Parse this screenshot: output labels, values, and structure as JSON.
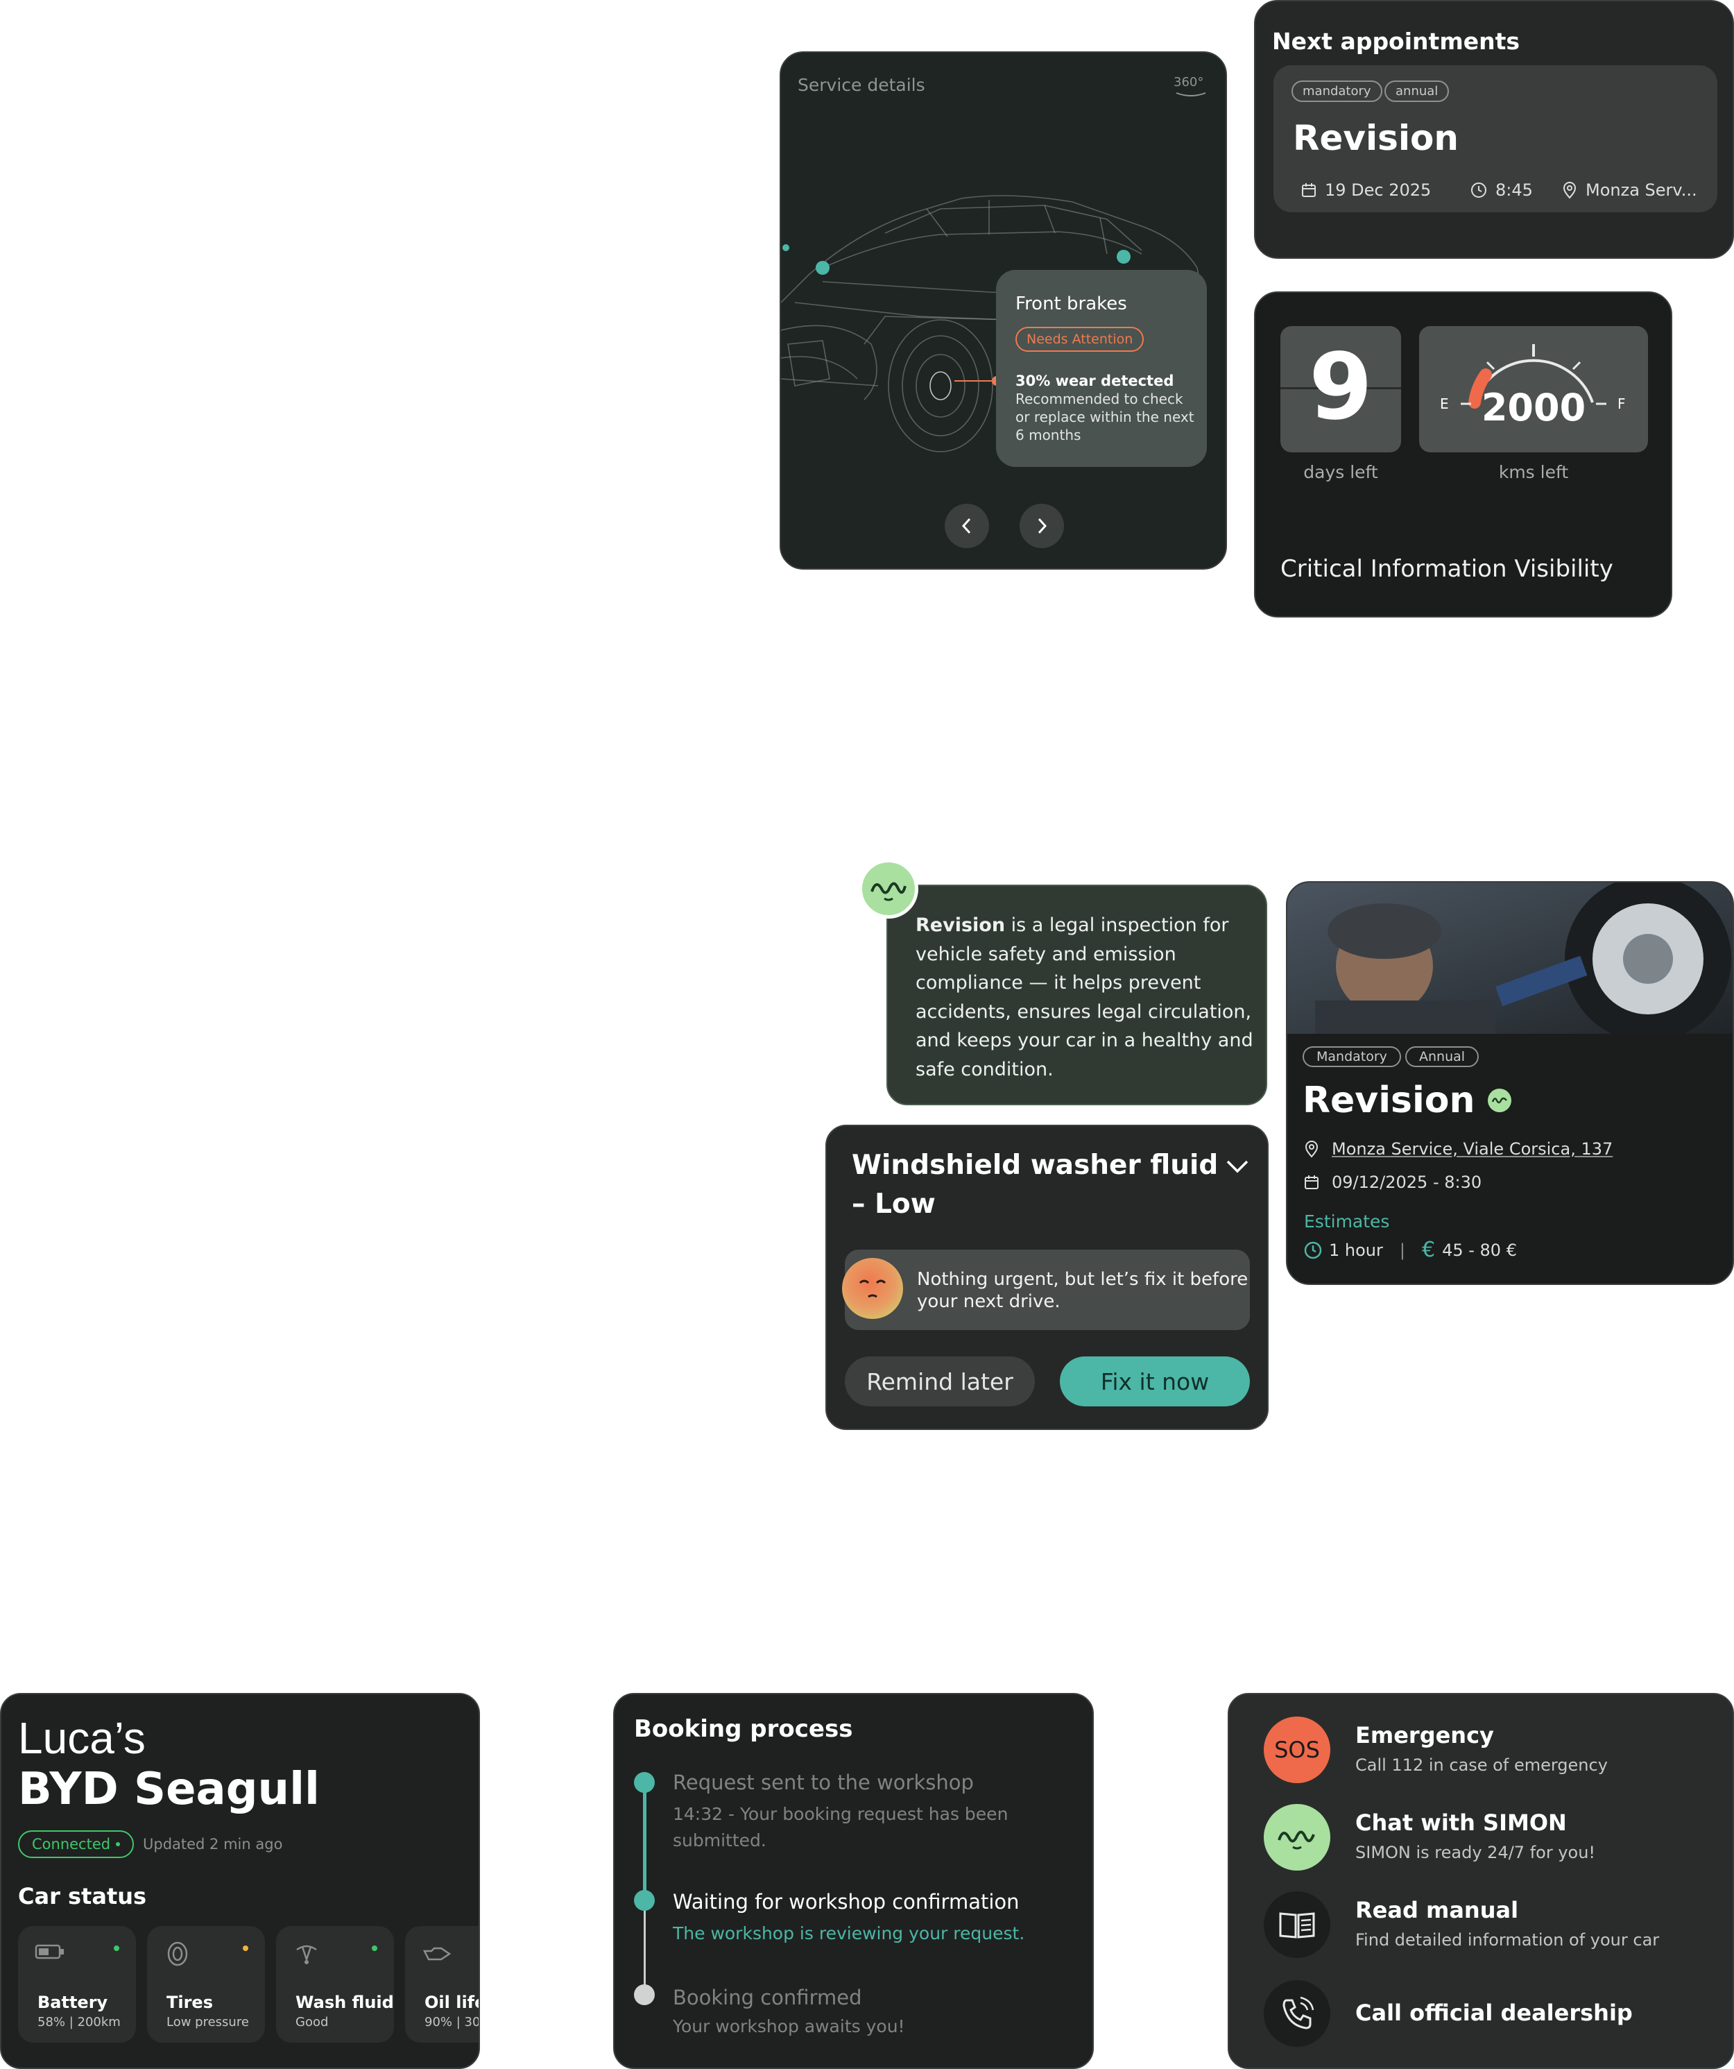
{
  "service": {
    "title": "Service details",
    "view_badge": "360°",
    "part": "Front brakes",
    "status": "Needs Attention",
    "wear": "30% wear detected",
    "recommendation_1": "Recommended to check",
    "recommendation_2": "or replace within the next",
    "recommendation_3": "6 months",
    "accent_color": "#ef7a4f",
    "highlight_color": "#4cb7a6"
  },
  "appointments": {
    "heading": "Next appointments",
    "tags": [
      "mandatory",
      "annual"
    ],
    "title": "Revision",
    "date": "19 Dec 2025",
    "time": "8:45",
    "place": "Monza Serv..."
  },
  "gauges": {
    "days_value": "9",
    "days_label": "days left",
    "kms_value": "2000",
    "kms_label": "kms left",
    "empty_mark": "E",
    "full_mark": "F",
    "caption": "Critical Information Visibility",
    "fuel_level_fraction": 0.15
  },
  "chat": {
    "bold": "Revision",
    "line_1": " is a legal inspection for",
    "line_2": "vehicle safety and emission",
    "line_3": "compliance — it helps prevent",
    "line_4": "accidents, ensures legal circulation,",
    "line_5": "and keeps your car in a healthy and",
    "line_6": "safe condition."
  },
  "revision": {
    "tags": [
      "Mandatory",
      "Annual"
    ],
    "title": "Revision",
    "address": "Monza Service, Viale Corsica, 137",
    "datetime": "09/12/2025 - 8:30",
    "estimates_label": "Estimates",
    "duration": "1 hour",
    "separator": "|",
    "cost": "45 - 80 €"
  },
  "washer": {
    "title_1": "Windshield washer fluid",
    "title_2": "– Low",
    "note_1": "Nothing urgent, but let’s fix it before",
    "note_2": "your next drive.",
    "remind_label": "Remind later",
    "fix_label": "Fix it now"
  },
  "car": {
    "owner": "Luca’s",
    "model": "BYD Seagull",
    "connection": "Connected",
    "updated": "Updated 2 min ago",
    "status_heading": "Car status",
    "items": [
      {
        "label": "Battery",
        "detail": "58% | 200km",
        "dot": "#3fc76a"
      },
      {
        "label": "Tires",
        "detail": "Low pressure",
        "dot": "#f0b43a"
      },
      {
        "label": "Wash fluid",
        "detail": "Good",
        "dot": "#3fc76a"
      },
      {
        "label": "Oil life",
        "detail": "90% | 30",
        "dot": "#3fc76a"
      }
    ]
  },
  "booking": {
    "heading": "Booking process",
    "steps": [
      {
        "title": "Request sent to the workshop",
        "detail_1": "14:32 - Your booking request has been",
        "detail_2": "submitted."
      },
      {
        "title": "Waiting for workshop confirmation",
        "detail_1": "The workshop is reviewing your request.",
        "detail_2": ""
      },
      {
        "title": "Booking confirmed",
        "detail_1": "Your workshop awaits you!",
        "detail_2": ""
      }
    ]
  },
  "help": {
    "items": [
      {
        "icon_text": "SOS",
        "title": "Emergency",
        "subtitle": "Call 112 in case of emergency"
      },
      {
        "icon_text": "",
        "title": "Chat with SIMON",
        "subtitle": "SIMON is ready 24/7 for you!"
      },
      {
        "icon_text": "",
        "title": "Read manual",
        "subtitle": "Find detailed information of your car"
      },
      {
        "icon_text": "",
        "title": "Call official dealership",
        "subtitle": ""
      }
    ]
  }
}
